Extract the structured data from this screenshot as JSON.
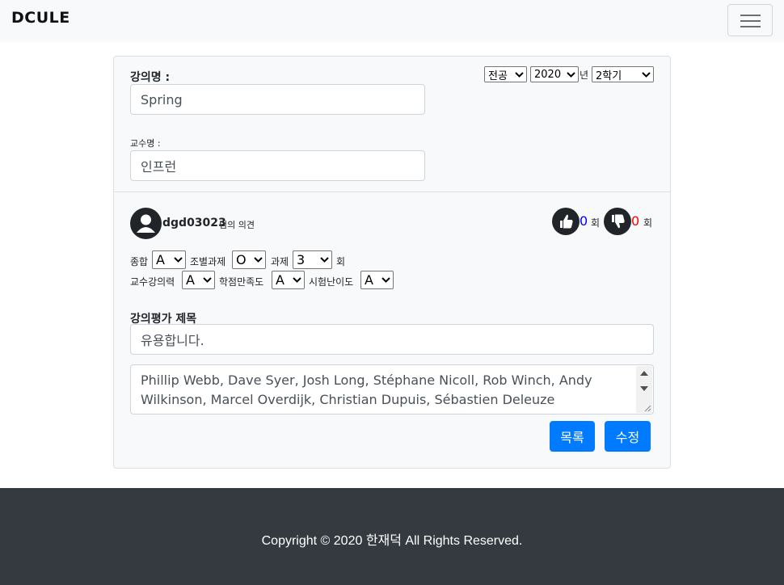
{
  "navbar": {
    "brand": "DCULE",
    "menu_icon": "hamburger-menu-icon"
  },
  "lecture": {
    "name_label": "강의명 :",
    "name_value": "Spring",
    "professor_label": "교수명 :",
    "professor_value": "인프런"
  },
  "filters": {
    "category": "전공",
    "year": "2020",
    "year_suffix": "년",
    "semester": "2학기"
  },
  "review": {
    "username": "dgd03023",
    "username_suffix": "님의 의견",
    "likes": "0",
    "dislikes": "0",
    "count_unit": "회",
    "ratings": {
      "overall_label": "종합",
      "overall": "A",
      "team_project_label": "조별과제",
      "team_project": "O",
      "assignment_label": "과제",
      "assignment": "3",
      "assignment_unit": "회",
      "teaching_label": "교수강의력",
      "teaching": "A",
      "grading_label": "학점만족도",
      "grading": "A",
      "exam_label": "시험난이도",
      "exam": "A"
    },
    "title_label": "강의평가 제목",
    "title_value": "유용합니다.",
    "content": "Phillip Webb, Dave Syer, Josh Long, Stéphane Nicoll, Rob Winch, Andy Wilkinson, Marcel Overdijk, Christian Dupuis, Sébastien Deleuze"
  },
  "buttons": {
    "list": "목록",
    "edit": "수정"
  },
  "footer": {
    "copyright": "Copyright © 2020 한재덕 All Rights Reserved."
  },
  "colors": {
    "primary": "#007bff",
    "like_count": "#0000ff",
    "dislike_count": "#ff0000",
    "footer_bg": "#343a40"
  }
}
